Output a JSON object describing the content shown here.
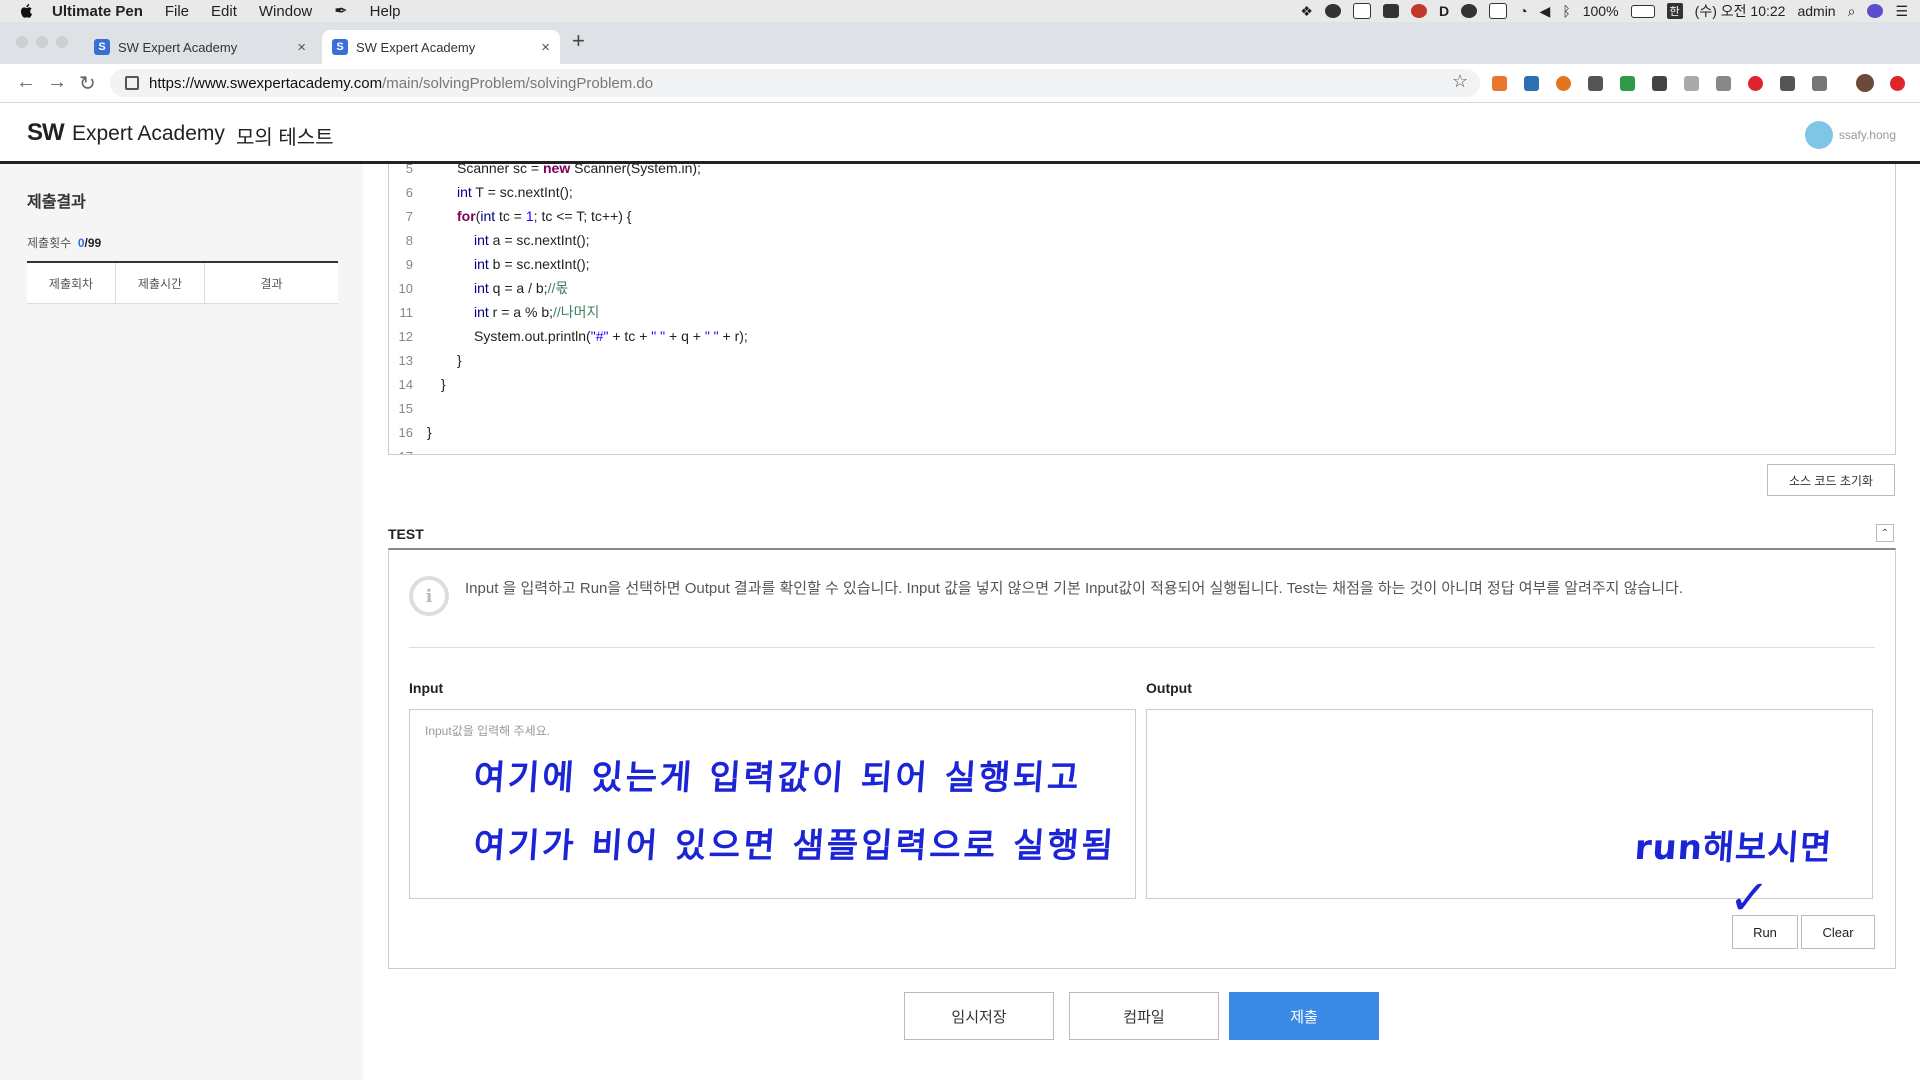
{
  "menubar": {
    "app_name": "Ultimate Pen",
    "menu_items": [
      "File",
      "Edit",
      "Window",
      "Help"
    ],
    "battery": "100%",
    "input_lang": "한",
    "clock": "(수) 오전 10:22",
    "user": "admin"
  },
  "browser": {
    "tabs": [
      {
        "title": "SW Expert Academy",
        "active": false
      },
      {
        "title": "SW Expert Academy",
        "active": true
      }
    ],
    "url_host": "https://www.swexpertacademy.com",
    "url_path": "/main/solvingProblem/solvingProblem.do"
  },
  "site": {
    "logo_sw": "SW",
    "logo_name": "Expert Academy",
    "mode": "모의 테스트",
    "username": "ssafy.hong"
  },
  "sidebar": {
    "title": "제출결과",
    "count_label": "제출횟수",
    "count_used": "0",
    "count_total": "/99",
    "columns": [
      "제출회차",
      "제출시간",
      "결과"
    ]
  },
  "editor": {
    "lines": [
      {
        "num": "5",
        "indent": 2
      },
      {
        "num": "6",
        "indent": 2
      },
      {
        "num": "7",
        "indent": 2
      },
      {
        "num": "8",
        "indent": 3
      },
      {
        "num": "9",
        "indent": 3
      },
      {
        "num": "10",
        "indent": 3
      },
      {
        "num": "11",
        "indent": 3
      },
      {
        "num": "12",
        "indent": 3
      },
      {
        "num": "13",
        "indent": 2
      },
      {
        "num": "14",
        "indent": 1
      },
      {
        "num": "15",
        "indent": 0
      },
      {
        "num": "16",
        "indent": 0
      }
    ],
    "reset_label": "소스 코드 초기화"
  },
  "test": {
    "title": "TEST",
    "info": "Input 을 입력하고 Run을 선택하면 Output 결과를 확인할 수 있습니다. Input 값을 넣지 않으면 기본 Input값이 적용되어 실행됩니다. Test는 채점을 하는 것이 아니며 정답 여부를 알려주지 않습니다.",
    "input_label": "Input",
    "output_label": "Output",
    "input_placeholder": "Input값을 입력해 주세요.",
    "run_label": "Run",
    "clear_label": "Clear"
  },
  "annotations": {
    "line1": "여기에 있는게 입력값이 되어 실행되고",
    "line2": "여기가 비어 있으면 샘플입력으로 실행됨",
    "run_note": "run해보시면",
    "checkmark": "✓"
  },
  "actions": {
    "save": "임시저장",
    "compile": "컴파일",
    "submit": "제출"
  },
  "colors": {
    "accent": "#3b8ae6",
    "handwriting": "#1b25d6"
  }
}
